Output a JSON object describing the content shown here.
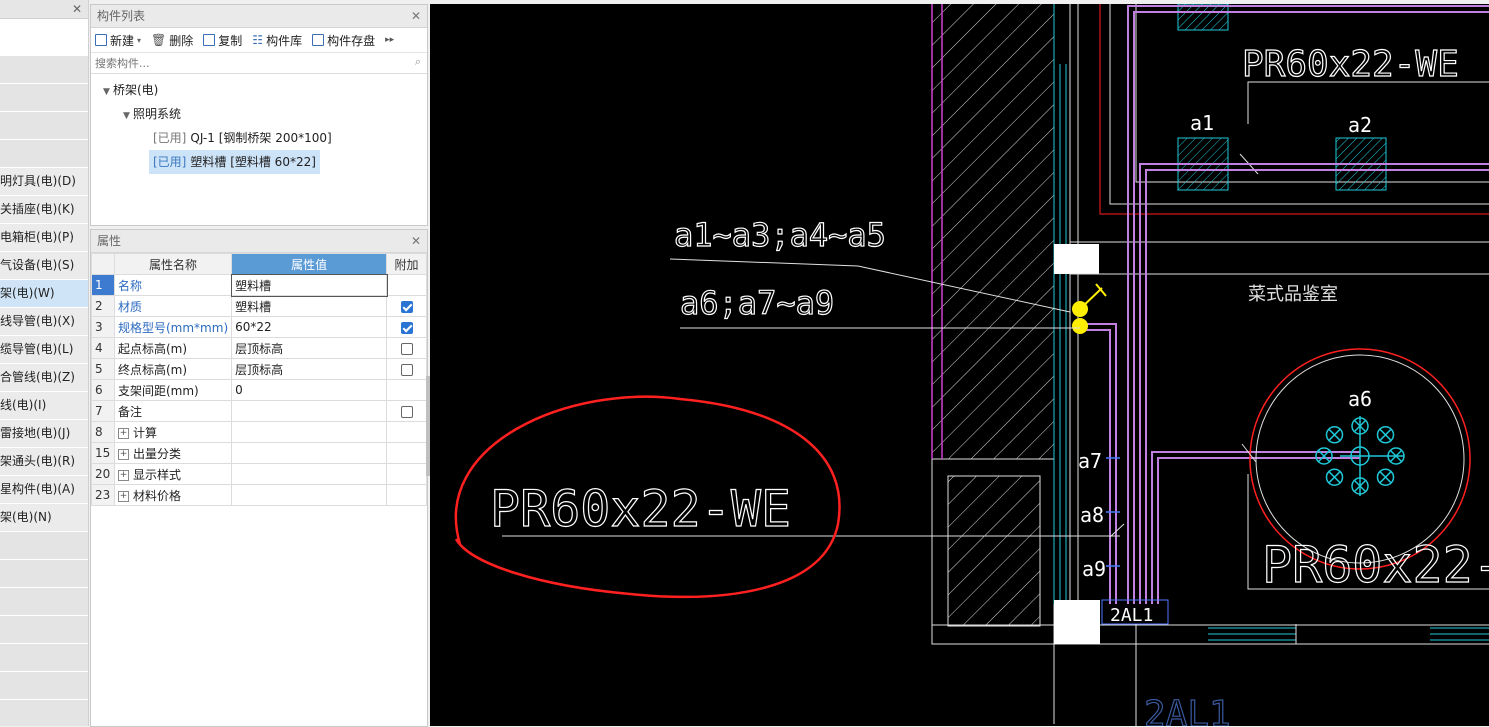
{
  "left_nav": {
    "items": [
      {
        "label": "",
        "style": "white"
      },
      {
        "label": "",
        "style": "blank"
      },
      {
        "label": "",
        "style": "blank"
      },
      {
        "label": "",
        "style": "blank"
      },
      {
        "label": "",
        "style": "blank"
      },
      {
        "label": "明灯具(电)(D)",
        "style": ""
      },
      {
        "label": "关插座(电)(K)",
        "style": ""
      },
      {
        "label": "电箱柜(电)(P)",
        "style": ""
      },
      {
        "label": "气设备(电)(S)",
        "style": ""
      },
      {
        "label": "架(电)(W)",
        "style": "sel"
      },
      {
        "label": "线导管(电)(X)",
        "style": ""
      },
      {
        "label": "缆导管(电)(L)",
        "style": ""
      },
      {
        "label": "合管线(电)(Z)",
        "style": ""
      },
      {
        "label": "线(电)(I)",
        "style": ""
      },
      {
        "label": "雷接地(电)(J)",
        "style": ""
      },
      {
        "label": "架通头(电)(R)",
        "style": ""
      },
      {
        "label": "星构件(电)(A)",
        "style": ""
      },
      {
        "label": "架(电)(N)",
        "style": ""
      },
      {
        "label": "",
        "style": "blank"
      },
      {
        "label": "",
        "style": "blank"
      },
      {
        "label": "",
        "style": "blank"
      },
      {
        "label": "",
        "style": "blank"
      },
      {
        "label": "",
        "style": "blank"
      },
      {
        "label": "",
        "style": "blank"
      },
      {
        "label": "",
        "style": "blank"
      }
    ]
  },
  "component_panel": {
    "title": "构件列表",
    "toolbar": {
      "new": "新建",
      "delete": "删除",
      "copy": "复制",
      "library": "构件库",
      "save": "构件存盘"
    },
    "search_placeholder": "搜索构件...",
    "tree": {
      "root": "桥架(电)",
      "group": "照明系统",
      "items": [
        {
          "tag": "[已用]",
          "name": "QJ-1 [钢制桥架 200*100]",
          "selected": false
        },
        {
          "tag": "[已用]",
          "name": "塑料槽 [塑料槽 60*22]",
          "selected": true
        }
      ]
    }
  },
  "props_panel": {
    "title": "属性",
    "headers": {
      "name": "属性名称",
      "value": "属性值",
      "extra": "附加"
    },
    "rows": [
      {
        "num": "1",
        "name": "名称",
        "value": "塑料槽",
        "check": "none",
        "blue": true,
        "active": true,
        "expand": false
      },
      {
        "num": "2",
        "name": "材质",
        "value": "塑料槽",
        "check": "on",
        "blue": true,
        "active": false,
        "expand": false
      },
      {
        "num": "3",
        "name": "规格型号(mm*mm)",
        "value": "60*22",
        "check": "on",
        "blue": true,
        "active": false,
        "expand": false
      },
      {
        "num": "4",
        "name": "起点标高(m)",
        "value": "层顶标高",
        "check": "off",
        "blue": false,
        "active": false,
        "expand": false
      },
      {
        "num": "5",
        "name": "终点标高(m)",
        "value": "层顶标高",
        "check": "off",
        "blue": false,
        "active": false,
        "expand": false
      },
      {
        "num": "6",
        "name": "支架间距(mm)",
        "value": "0",
        "check": "none",
        "blue": false,
        "active": false,
        "expand": false
      },
      {
        "num": "7",
        "name": "备注",
        "value": "",
        "check": "off",
        "blue": false,
        "active": false,
        "expand": false
      },
      {
        "num": "8",
        "name": "计算",
        "value": "",
        "check": "none",
        "blue": false,
        "active": false,
        "expand": true
      },
      {
        "num": "15",
        "name": "出量分类",
        "value": "",
        "check": "none",
        "blue": false,
        "active": false,
        "expand": true
      },
      {
        "num": "20",
        "name": "显示样式",
        "value": "",
        "check": "none",
        "blue": false,
        "active": false,
        "expand": true
      },
      {
        "num": "23",
        "name": "材料价格",
        "value": "",
        "check": "none",
        "blue": false,
        "active": false,
        "expand": true
      }
    ]
  },
  "drawing": {
    "label_spec_main": "PR60x22-WE",
    "label_spec_top": "PR60x22-WE",
    "label_spec_right": "PR60x22-",
    "label_a1_a5": "a1~a3;a4~a5",
    "label_a6_a9": "a6;a7~a9",
    "label_a1": "a1",
    "label_a2": "a2",
    "label_a6": "a6",
    "label_a7": "a7",
    "label_a8": "a8",
    "label_a9": "a9",
    "label_room": "菜式品鉴室",
    "label_panel": "2AL1",
    "label_panel_below": "2AL1",
    "colors": {
      "purple": "#c080e0",
      "cyan": "#1fc8d8",
      "red": "#ff2020",
      "magenta": "#d040d0",
      "white": "#ffffff",
      "yellow": "#ffee00",
      "blue": "#4a7aff"
    }
  }
}
